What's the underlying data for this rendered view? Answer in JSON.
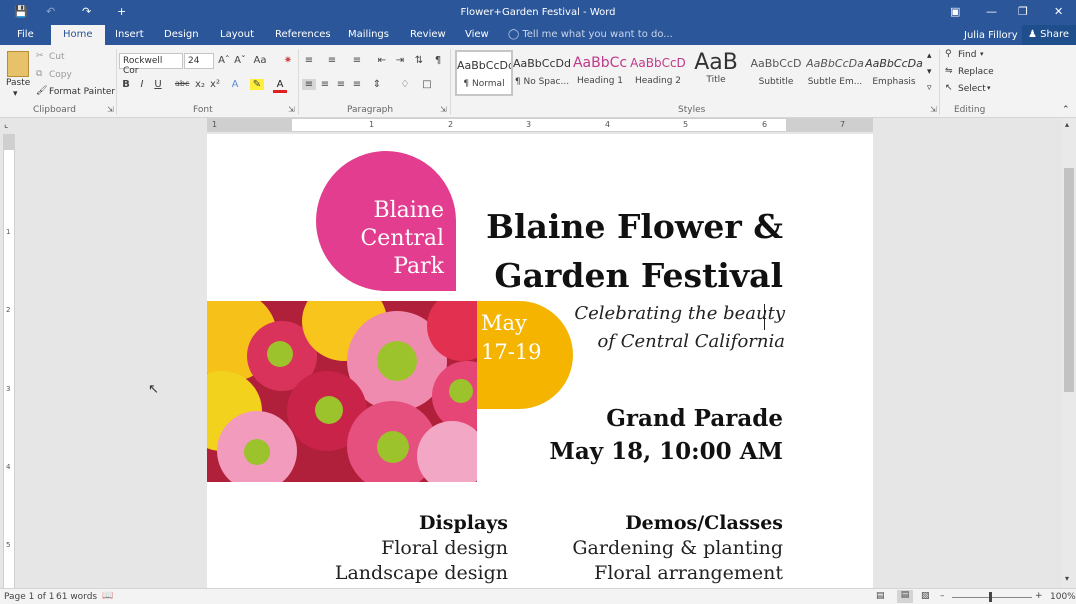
{
  "titlebar": {
    "title": "Flower+Garden Festival - Word",
    "qat_plus": "+"
  },
  "tabs": [
    "File",
    "Home",
    "Insert",
    "Design",
    "Layout",
    "References",
    "Mailings",
    "Review",
    "View"
  ],
  "tell_me": "Tell me what you want to do...",
  "user": "Julia Fillory",
  "share": "Share",
  "clipboard": {
    "paste": "Paste",
    "cut": "Cut",
    "copy": "Copy",
    "format_painter": "Format Painter",
    "label": "Clipboard"
  },
  "font": {
    "name": "Rockwell Cor",
    "size": "24",
    "label": "Font"
  },
  "paragraph": {
    "label": "Paragraph"
  },
  "styles": {
    "label": "Styles",
    "items": [
      {
        "preview": "AaBbCcDd",
        "name": "¶ Normal"
      },
      {
        "preview": "AaBbCcDd",
        "name": "¶ No Spac..."
      },
      {
        "preview": "AaBbCc",
        "name": "Heading 1"
      },
      {
        "preview": "AaBbCcD",
        "name": "Heading 2"
      },
      {
        "preview": "AaB",
        "name": "Title"
      },
      {
        "preview": "AaBbCcD",
        "name": "Subtitle"
      },
      {
        "preview": "AaBbCcDa",
        "name": "Subtle Em..."
      },
      {
        "preview": "AaBbCcDa",
        "name": "Emphasis"
      }
    ]
  },
  "editing": {
    "find": "Find",
    "replace": "Replace",
    "select": "Select",
    "label": "Editing"
  },
  "ruler": {
    "h_numbers": [
      "1",
      "1",
      "2",
      "3",
      "4",
      "5",
      "6",
      "7"
    ],
    "v_numbers": [
      "1",
      "2",
      "3",
      "4",
      "5"
    ]
  },
  "document": {
    "badge": [
      "Blaine",
      "Central",
      "Park"
    ],
    "date_badge": [
      "May",
      "17-19"
    ],
    "headline": [
      "Blaine Flower &",
      "Garden Festival"
    ],
    "tagline": [
      "Celebrating the beauty",
      "of Central California"
    ],
    "parade": [
      "Grand Parade",
      "May 18, 10:00 AM"
    ],
    "displays": {
      "heading": "Displays",
      "items": [
        "Floral design",
        "Landscape design"
      ]
    },
    "demos": {
      "heading": "Demos/Classes",
      "items": [
        "Gardening & planting",
        "Floral arrangement"
      ]
    }
  },
  "status": {
    "page": "Page 1 of 1",
    "words": "61 words",
    "zoom": "100%"
  }
}
